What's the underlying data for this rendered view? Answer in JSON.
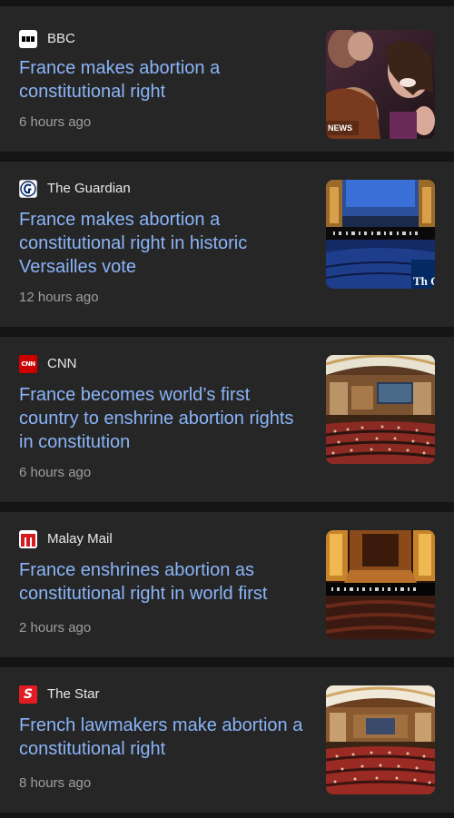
{
  "articles": [
    {
      "source": "BBC",
      "title": "France makes abortion a constitutional right",
      "time": "6 hours ago",
      "image_caption": "NEWS",
      "logo_icon": "bbc-logo-icon",
      "colors": {
        "logo_bg": "#ffffff",
        "logo_fg": "#000000"
      }
    },
    {
      "source": "The Guardian",
      "title": "France makes abortion a constitutional right in historic Versailles vote",
      "time": "12 hours ago",
      "image_caption": "Th Gua",
      "logo_icon": "guardian-logo-icon",
      "colors": {
        "logo_bg": "#ffffff",
        "logo_fg": "#052962"
      }
    },
    {
      "source": "CNN",
      "title": "France becomes world’s first country to enshrine abortion rights in constitution",
      "time": "6 hours ago",
      "image_caption": "",
      "logo_icon": "cnn-logo-icon",
      "colors": {
        "logo_bg": "#cc0000",
        "logo_fg": "#ffffff"
      }
    },
    {
      "source": "Malay Mail",
      "title": "France enshrines abortion as constitutional right in world first",
      "time": "2 hours ago",
      "image_caption": "",
      "logo_icon": "malay-mail-logo-icon",
      "colors": {
        "logo_bg": "#ffffff",
        "logo_fg": "#d71920"
      }
    },
    {
      "source": "The Star",
      "title": "French lawmakers make abortion a constitutional right",
      "time": "8 hours ago",
      "image_caption": "",
      "logo_icon": "the-star-logo-icon",
      "colors": {
        "logo_bg": "#e31b23",
        "logo_fg": "#ffffff"
      }
    }
  ],
  "colors": {
    "background": "#141414",
    "card": "#262626",
    "headline": "#8ab4f8",
    "source_text": "#e8e8e8",
    "time_text": "#9e9e9e"
  }
}
